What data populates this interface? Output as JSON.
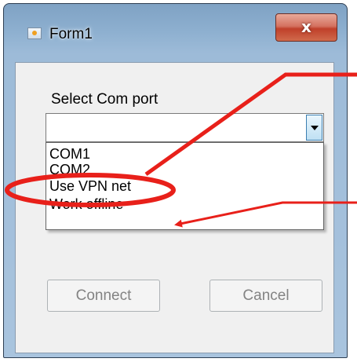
{
  "window": {
    "title": "Form1",
    "close_label": "x"
  },
  "form": {
    "label": "Select Com port",
    "combo_value": "",
    "options": [
      "COM1",
      "COM2",
      "Use VPN net",
      "Work offline"
    ]
  },
  "buttons": {
    "connect_label": "Connect",
    "cancel_label": "Cancel"
  },
  "annotation": {
    "color": "#e8201a",
    "highlighted_option": "Use VPN net"
  }
}
